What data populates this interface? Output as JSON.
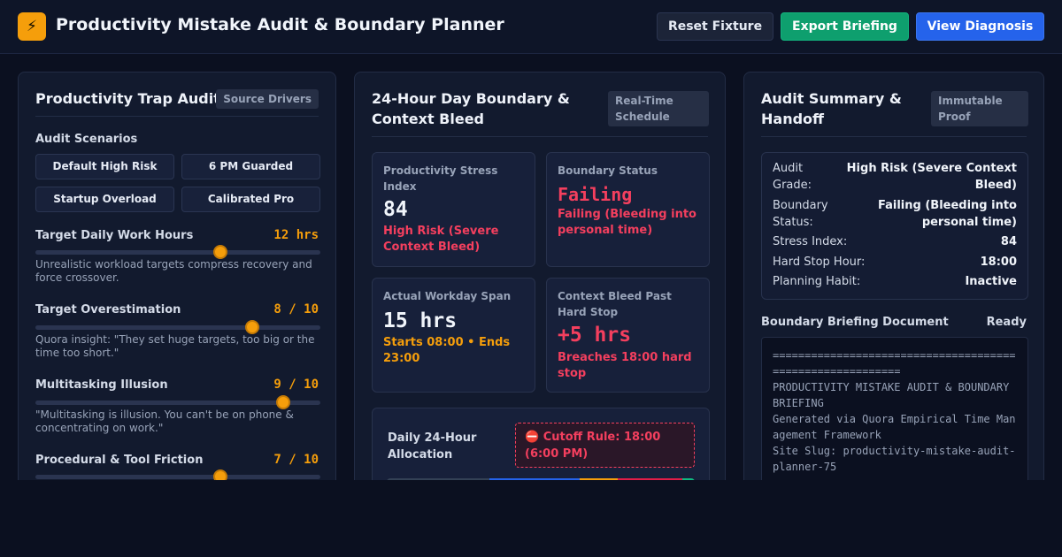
{
  "app": {
    "logo_icon": "⚡",
    "title": "Productivity Mistake Audit & Boundary Planner"
  },
  "toolbar": {
    "reset_label": "Reset Fixture",
    "export_label": "Export Briefing",
    "view_label": "View Diagnosis"
  },
  "audit_panel": {
    "title": "Productivity Trap Audit",
    "badge": "Source Drivers",
    "scenarios_label": "Audit Scenarios",
    "scenarios": [
      "Default High Risk",
      "6 PM Guarded",
      "Startup Overload",
      "Calibrated Pro"
    ],
    "sliders": [
      {
        "label": "Target Daily Work Hours",
        "value_text": "12 hrs",
        "fraction": 0.65,
        "hint": "Unrealistic workload targets compress recovery and force crossover."
      },
      {
        "label": "Target Overestimation",
        "value_text": "8 / 10",
        "fraction": 0.76,
        "hint": "Quora insight: \"They set huge targets, too big or the time too short.\""
      },
      {
        "label": "Multitasking Illusion",
        "value_text": "9 / 10",
        "fraction": 0.87,
        "hint": "\"Multitasking is illusion. You can't be on phone & concentrating on work.\""
      },
      {
        "label": "Procedural & Tool Friction",
        "value_text": "7 / 10",
        "fraction": 0.65,
        "hint": ""
      }
    ]
  },
  "boundary_panel": {
    "title": "24-Hour Day Boundary & Context Bleed",
    "badge": "Real-Time Schedule",
    "cards": {
      "stress": {
        "label": "Productivity Stress Index",
        "value": "84",
        "sub": "High Risk (Severe Context Bleed)"
      },
      "status": {
        "label": "Boundary Status",
        "value": "Failing",
        "sub": "Failing (Bleeding into personal time)"
      },
      "span": {
        "label": "Actual Workday Span",
        "value": "15 hrs",
        "sub": "Starts 08:00 • Ends 23:00"
      },
      "bleed": {
        "label": "Context Bleed Past Hard Stop",
        "value": "+5 hrs",
        "sub": "Breaches 18:00 hard stop"
      }
    },
    "allocation": {
      "label": "Daily 24-Hour Allocation",
      "cutoff": "⛔ Cutoff Rule: 18:00 (6:00 PM)",
      "segments": [
        {
          "hours": 8,
          "color": "#334155"
        },
        {
          "hours": 7,
          "color": "#2563eb"
        },
        {
          "hours": 3,
          "color": "#f59e0b"
        },
        {
          "hours": 5,
          "color": "#e11d48"
        },
        {
          "hours": 1,
          "color": "#10b981"
        }
      ]
    }
  },
  "summary_panel": {
    "title": "Audit Summary & Handoff",
    "badge": "Immutable Proof",
    "rows": [
      {
        "k": "Audit Grade:",
        "v": "High Risk (Severe Context Bleed)"
      },
      {
        "k": "Boundary Status:",
        "v": "Failing (Bleeding into personal time)"
      },
      {
        "k": "Stress Index:",
        "v": "84"
      },
      {
        "k": "Hard Stop Hour:",
        "v": "18:00"
      },
      {
        "k": "Planning Habit:",
        "v": "Inactive"
      }
    ],
    "doc_label": "Boundary Briefing Document",
    "doc_status": "Ready",
    "doc_text": "==========================================================\nPRODUCTIVITY MISTAKE AUDIT & BOUNDARY BRIEFING\nGenerated via Quora Empirical Time Management Framework\nSite Slug: productivity-mistake-audit-planner-75"
  },
  "colors": {
    "accent": "#f59e0b",
    "danger": "#f43f5e",
    "success": "#0e9f6e",
    "primary": "#2563eb"
  }
}
